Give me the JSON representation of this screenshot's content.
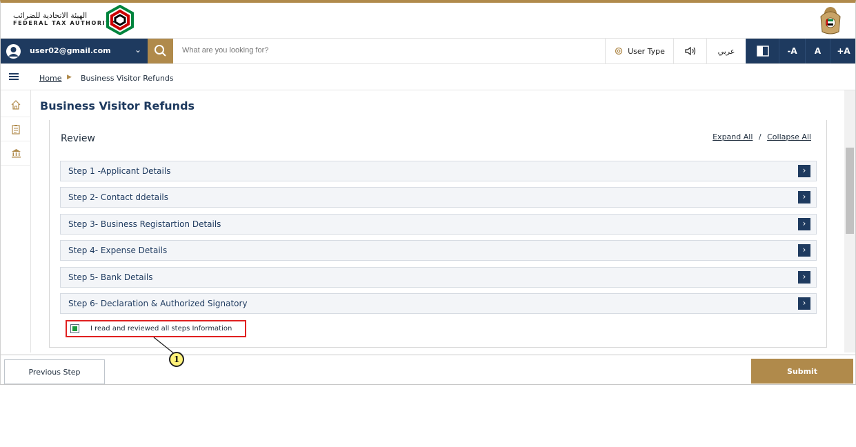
{
  "header": {
    "logo_arabic": "الهيئة الاتحادية للضرائب",
    "logo_english": "FEDERAL TAX AUTHORITY",
    "logo_colors": [
      "#00843d",
      "#cc0000",
      "#000000"
    ]
  },
  "navbar": {
    "user_email": "user02@gmail.com",
    "search_placeholder": "What are you looking for?",
    "user_type_label": "User Type",
    "arabic_label": "عربي",
    "font_decrease": "-A",
    "font_normal": "A",
    "font_increase": "+A"
  },
  "breadcrumb": {
    "home": "Home",
    "current": "Business Visitor Refunds"
  },
  "page": {
    "title": "Business Visitor Refunds"
  },
  "review": {
    "title": "Review",
    "expand_all": "Expand All",
    "separator": "/",
    "collapse_all": "Collapse All",
    "steps": [
      "Step 1 -Applicant Details",
      "Step 2- Contact ddetails",
      "Step 3- Business Registartion Details",
      "Step 4- Expense Details",
      "Step 5- Bank Details",
      "Step 6- Declaration & Authorized Signatory"
    ],
    "acknowledge_label": "I read and reviewed all steps Information",
    "acknowledge_checked": true,
    "callout_number": "1"
  },
  "footer": {
    "previous_label": "Previous Step",
    "submit_label": "Submit"
  },
  "colors": {
    "primary": "#1e3a5f",
    "accent_gold": "#b08a4b",
    "highlight_red": "#e02020",
    "check_green": "#1d9a3d"
  }
}
